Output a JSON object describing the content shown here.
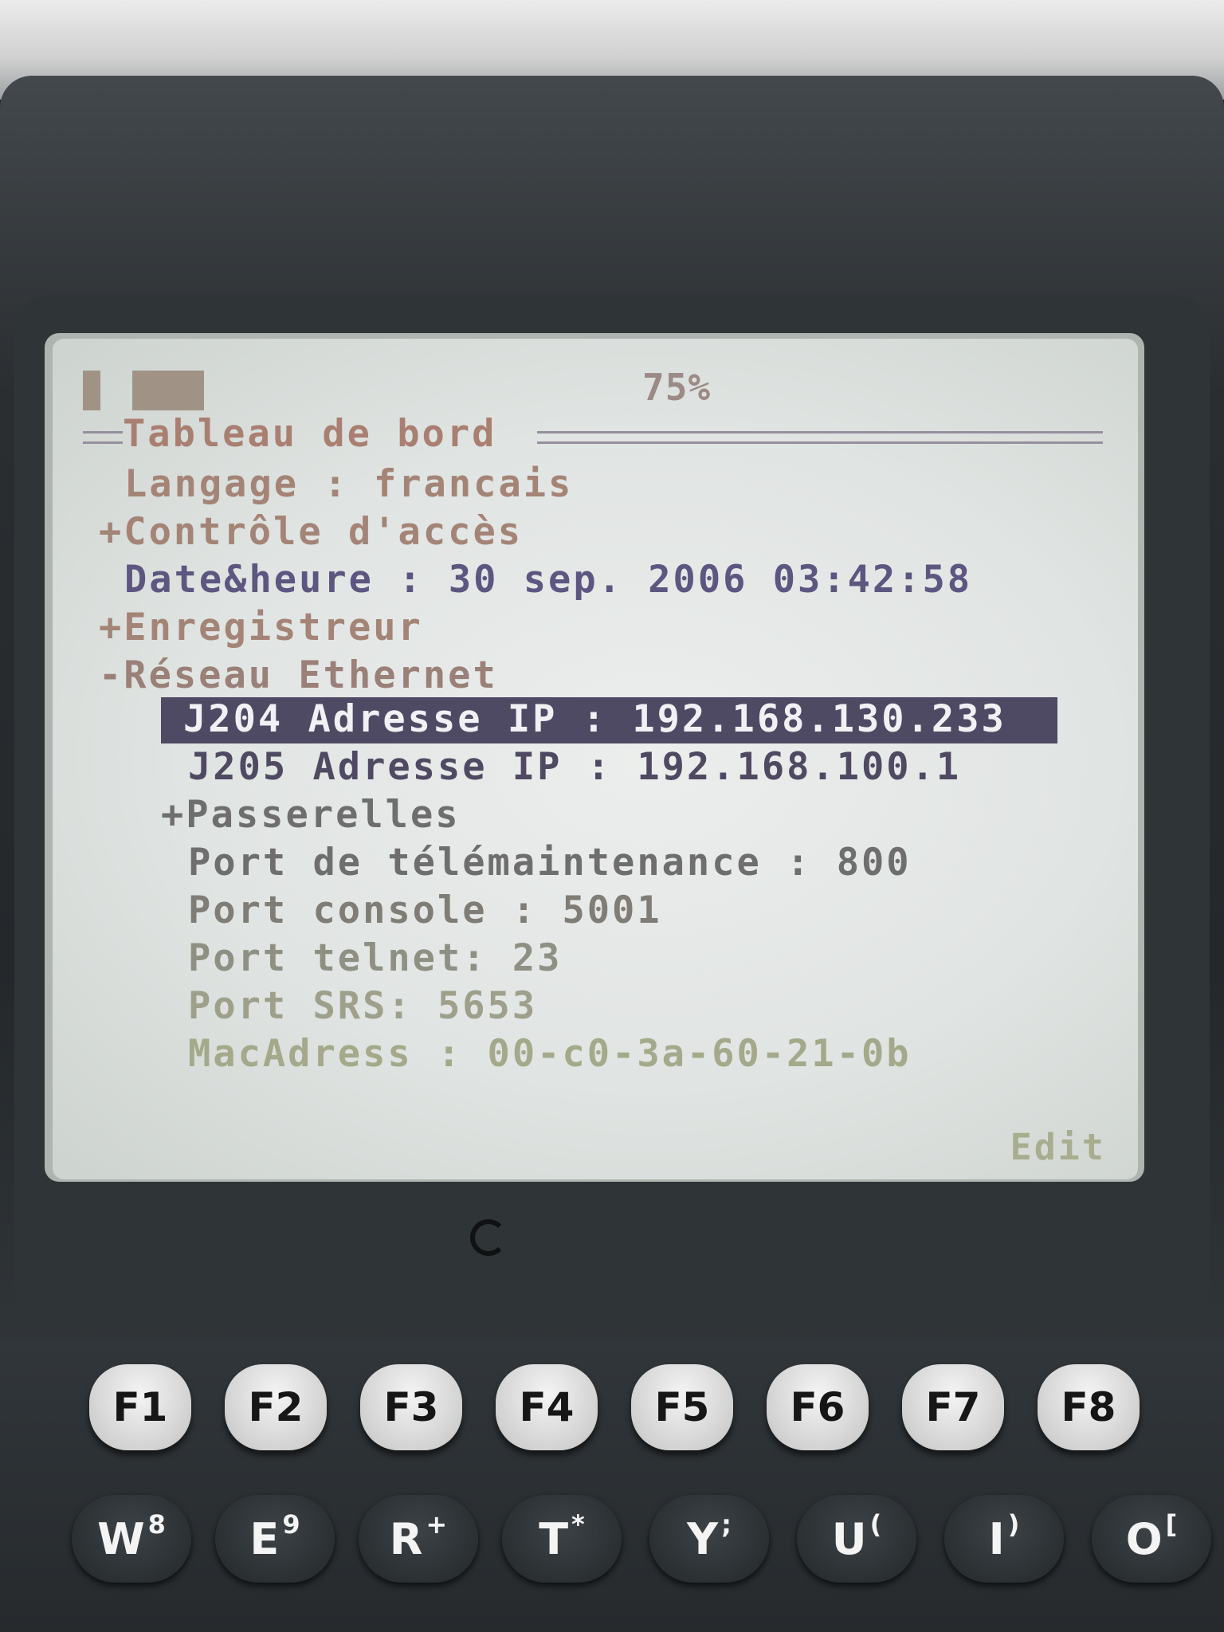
{
  "status": {
    "battery_percent": "75%"
  },
  "menu": {
    "title": "Tableau de bord",
    "items": [
      {
        "text": "Langage : francais"
      },
      {
        "text": "+Contrôle d'accès"
      },
      {
        "text": "Date&heure : 30 sep. 2006 03:42:58"
      },
      {
        "text": "+Enregistreur"
      },
      {
        "text": "-Réseau Ethernet"
      },
      {
        "text": "J204 Adresse IP : 192.168.130.233"
      },
      {
        "text": "J205 Adresse IP : 192.168.100.1"
      },
      {
        "text": "+Passerelles"
      },
      {
        "text": "Port de télémaintenance : 800"
      },
      {
        "text": "Port console : 5001"
      },
      {
        "text": "Port telnet: 23"
      },
      {
        "text": "Port SRS: 5653"
      },
      {
        "text": "MacAdress : 00-c0-3a-60-21-0b"
      }
    ],
    "softkey": "Edit"
  },
  "keys": {
    "function": [
      "F1",
      "F2",
      "F3",
      "F4",
      "F5",
      "F6",
      "F7",
      "F8"
    ],
    "letters": [
      {
        "main": "W",
        "alt": "8"
      },
      {
        "main": "E",
        "alt": "9"
      },
      {
        "main": "R",
        "alt": "+"
      },
      {
        "main": "T",
        "alt": "*"
      },
      {
        "main": "Y",
        "alt": ";"
      },
      {
        "main": "U",
        "alt": "("
      },
      {
        "main": "I",
        "alt": ")"
      },
      {
        "main": "O",
        "alt": "["
      }
    ]
  }
}
